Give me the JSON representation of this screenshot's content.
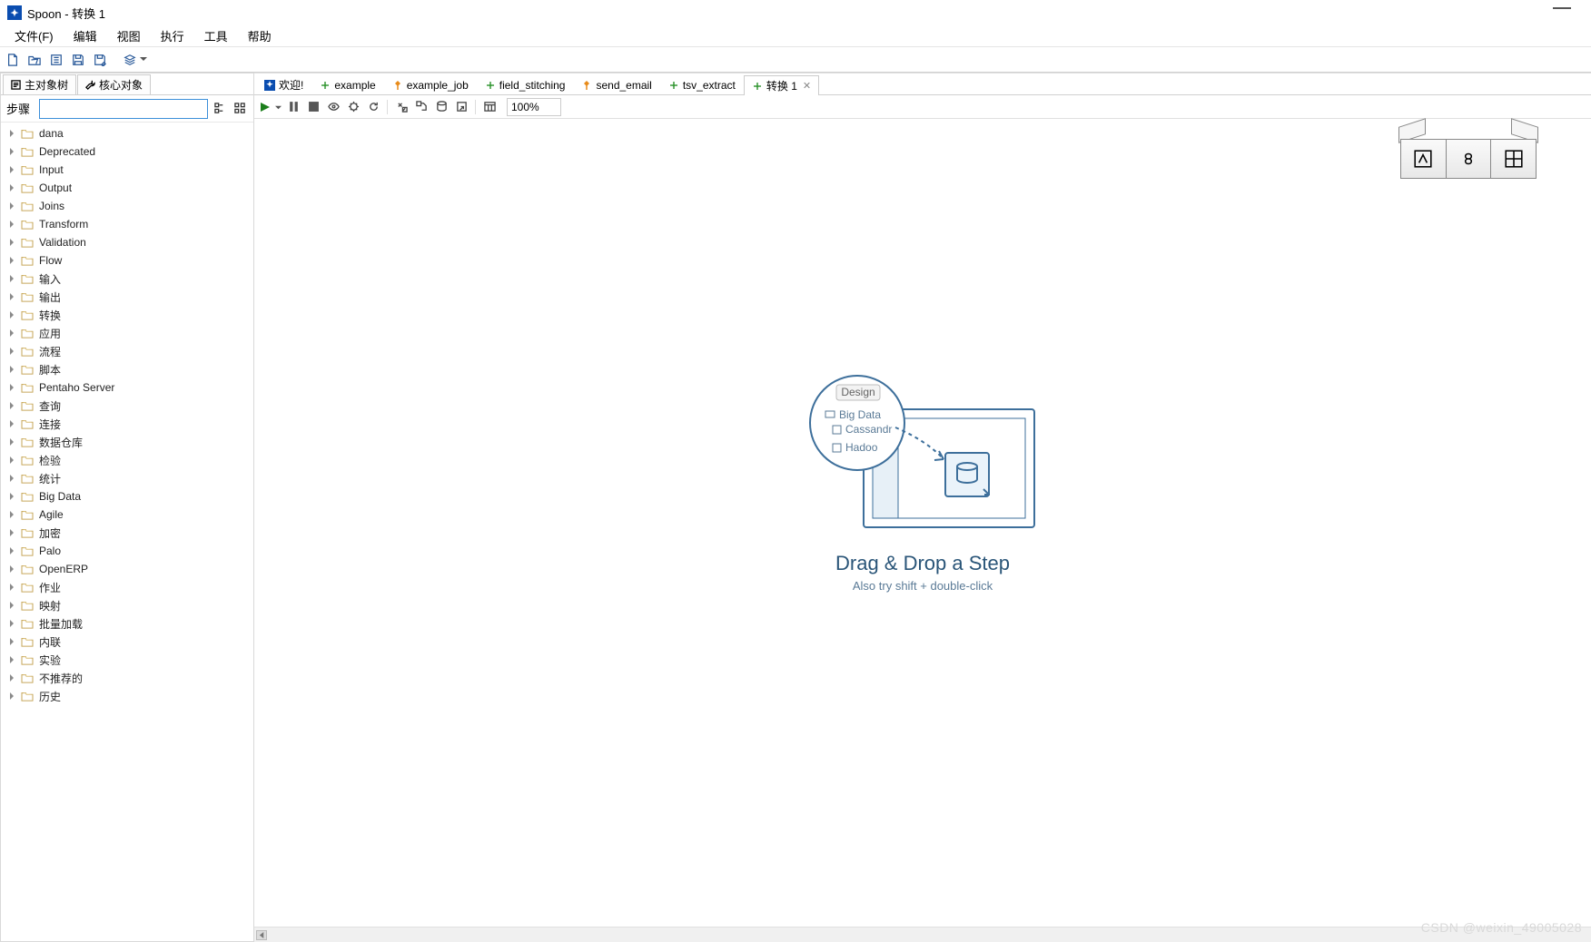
{
  "window": {
    "title": "Spoon - 转换 1",
    "minimize_symbol": "—"
  },
  "menu": {
    "items": [
      "文件(F)",
      "编辑",
      "视图",
      "执行",
      "工具",
      "帮助"
    ]
  },
  "sidebar": {
    "tabs": [
      {
        "label": "主对象树",
        "icon": "doc-tree-icon"
      },
      {
        "label": "核心对象",
        "icon": "wrench-icon"
      }
    ],
    "steps_label": "步骤",
    "search_value": "",
    "categories": [
      "dana",
      "Deprecated",
      "Input",
      "Output",
      "Joins",
      "Transform",
      "Validation",
      "Flow",
      "输入",
      "输出",
      "转换",
      "应用",
      "流程",
      "脚本",
      "Pentaho Server",
      "查询",
      "连接",
      "数据仓库",
      "检验",
      "统计",
      "Big Data",
      "Agile",
      "加密",
      "Palo",
      "OpenERP",
      "作业",
      "映射",
      "批量加载",
      "内联",
      "实验",
      "不推荐的",
      "历史"
    ]
  },
  "editor_tabs": [
    {
      "label": "欢迎!",
      "icon": "spoon-app-icon",
      "active": false,
      "closable": false
    },
    {
      "label": "example",
      "icon": "transformation-icon",
      "active": false,
      "closable": false
    },
    {
      "label": "example_job",
      "icon": "job-icon",
      "active": false,
      "closable": false
    },
    {
      "label": "field_stitching",
      "icon": "transformation-icon",
      "active": false,
      "closable": false
    },
    {
      "label": "send_email",
      "icon": "job-icon",
      "active": false,
      "closable": false
    },
    {
      "label": "tsv_extract",
      "icon": "transformation-icon",
      "active": false,
      "closable": false
    },
    {
      "label": "转换 1",
      "icon": "transformation-icon",
      "active": true,
      "closable": true
    }
  ],
  "canvas_toolbar": {
    "zoom": "100%"
  },
  "placeholder": {
    "tab_label": "Design",
    "items": [
      "Big Data",
      "Cassandr",
      "Hadoo"
    ],
    "title": "Drag & Drop a Step",
    "subtitle": "Also try shift + double-click"
  },
  "watermark": "CSDN @weixin_49005028"
}
